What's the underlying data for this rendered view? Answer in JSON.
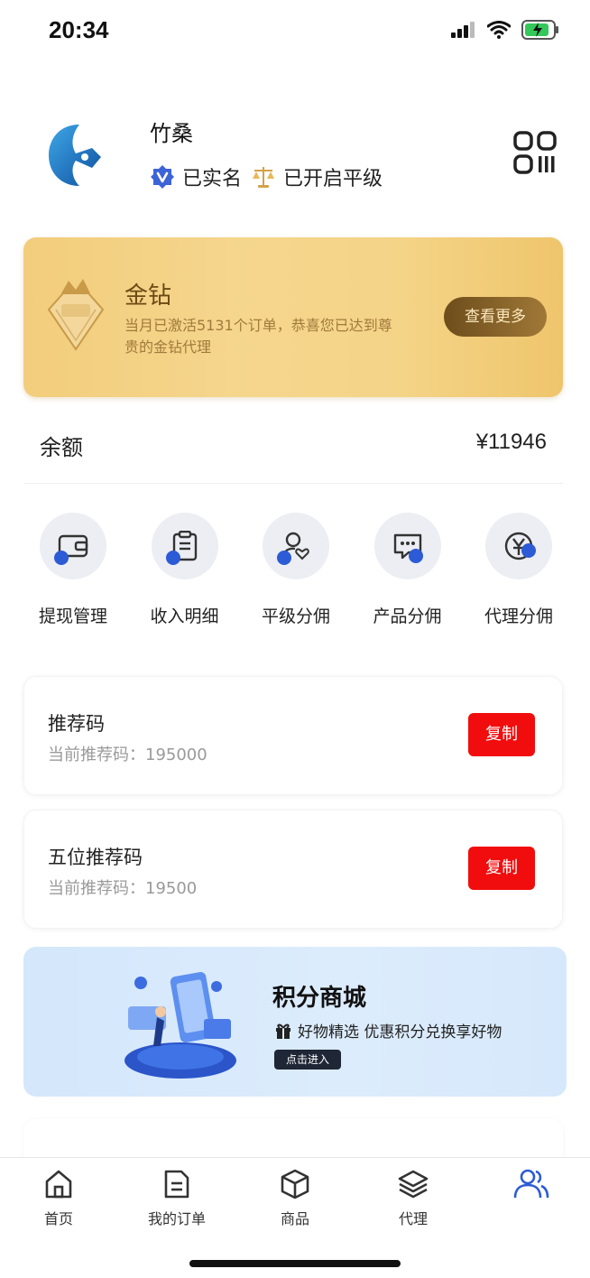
{
  "status_bar": {
    "time": "20:34"
  },
  "profile": {
    "name": "竹桑",
    "verified_label": "已实名",
    "level_label": "已开启平级"
  },
  "gold_card": {
    "title": "金钻",
    "description": "当月已激活5131个订单，恭喜您已达到尊贵的金钻代理",
    "more_label": "查看更多"
  },
  "balance": {
    "label": "余额",
    "value": "¥11946"
  },
  "quick_actions": [
    {
      "label": "提现管理",
      "icon": "wallet-icon"
    },
    {
      "label": "收入明细",
      "icon": "clipboard-icon"
    },
    {
      "label": "平级分佣",
      "icon": "user-heart-icon"
    },
    {
      "label": "产品分佣",
      "icon": "message-icon"
    },
    {
      "label": "代理分佣",
      "icon": "yen-icon"
    }
  ],
  "referral_cards": [
    {
      "title": "推荐码",
      "subtitle": "当前推荐码：195000",
      "button": "复制"
    },
    {
      "title": "五位推荐码",
      "subtitle": "当前推荐码：19500",
      "button": "复制"
    }
  ],
  "mall_banner": {
    "title": "积分商城",
    "description": "好物精选 优惠积分兑换享好物",
    "button": "点击进入"
  },
  "tabbar": [
    {
      "label": "首页",
      "icon": "home-icon"
    },
    {
      "label": "我的订单",
      "icon": "document-icon"
    },
    {
      "label": "商品",
      "icon": "box-icon"
    },
    {
      "label": "代理",
      "icon": "layers-icon"
    },
    {
      "label": "",
      "icon": "users-icon"
    }
  ],
  "colors": {
    "accent": "#2d5bd6",
    "copy_button": "#f10d0d",
    "gold_text": "#6b4a16"
  }
}
